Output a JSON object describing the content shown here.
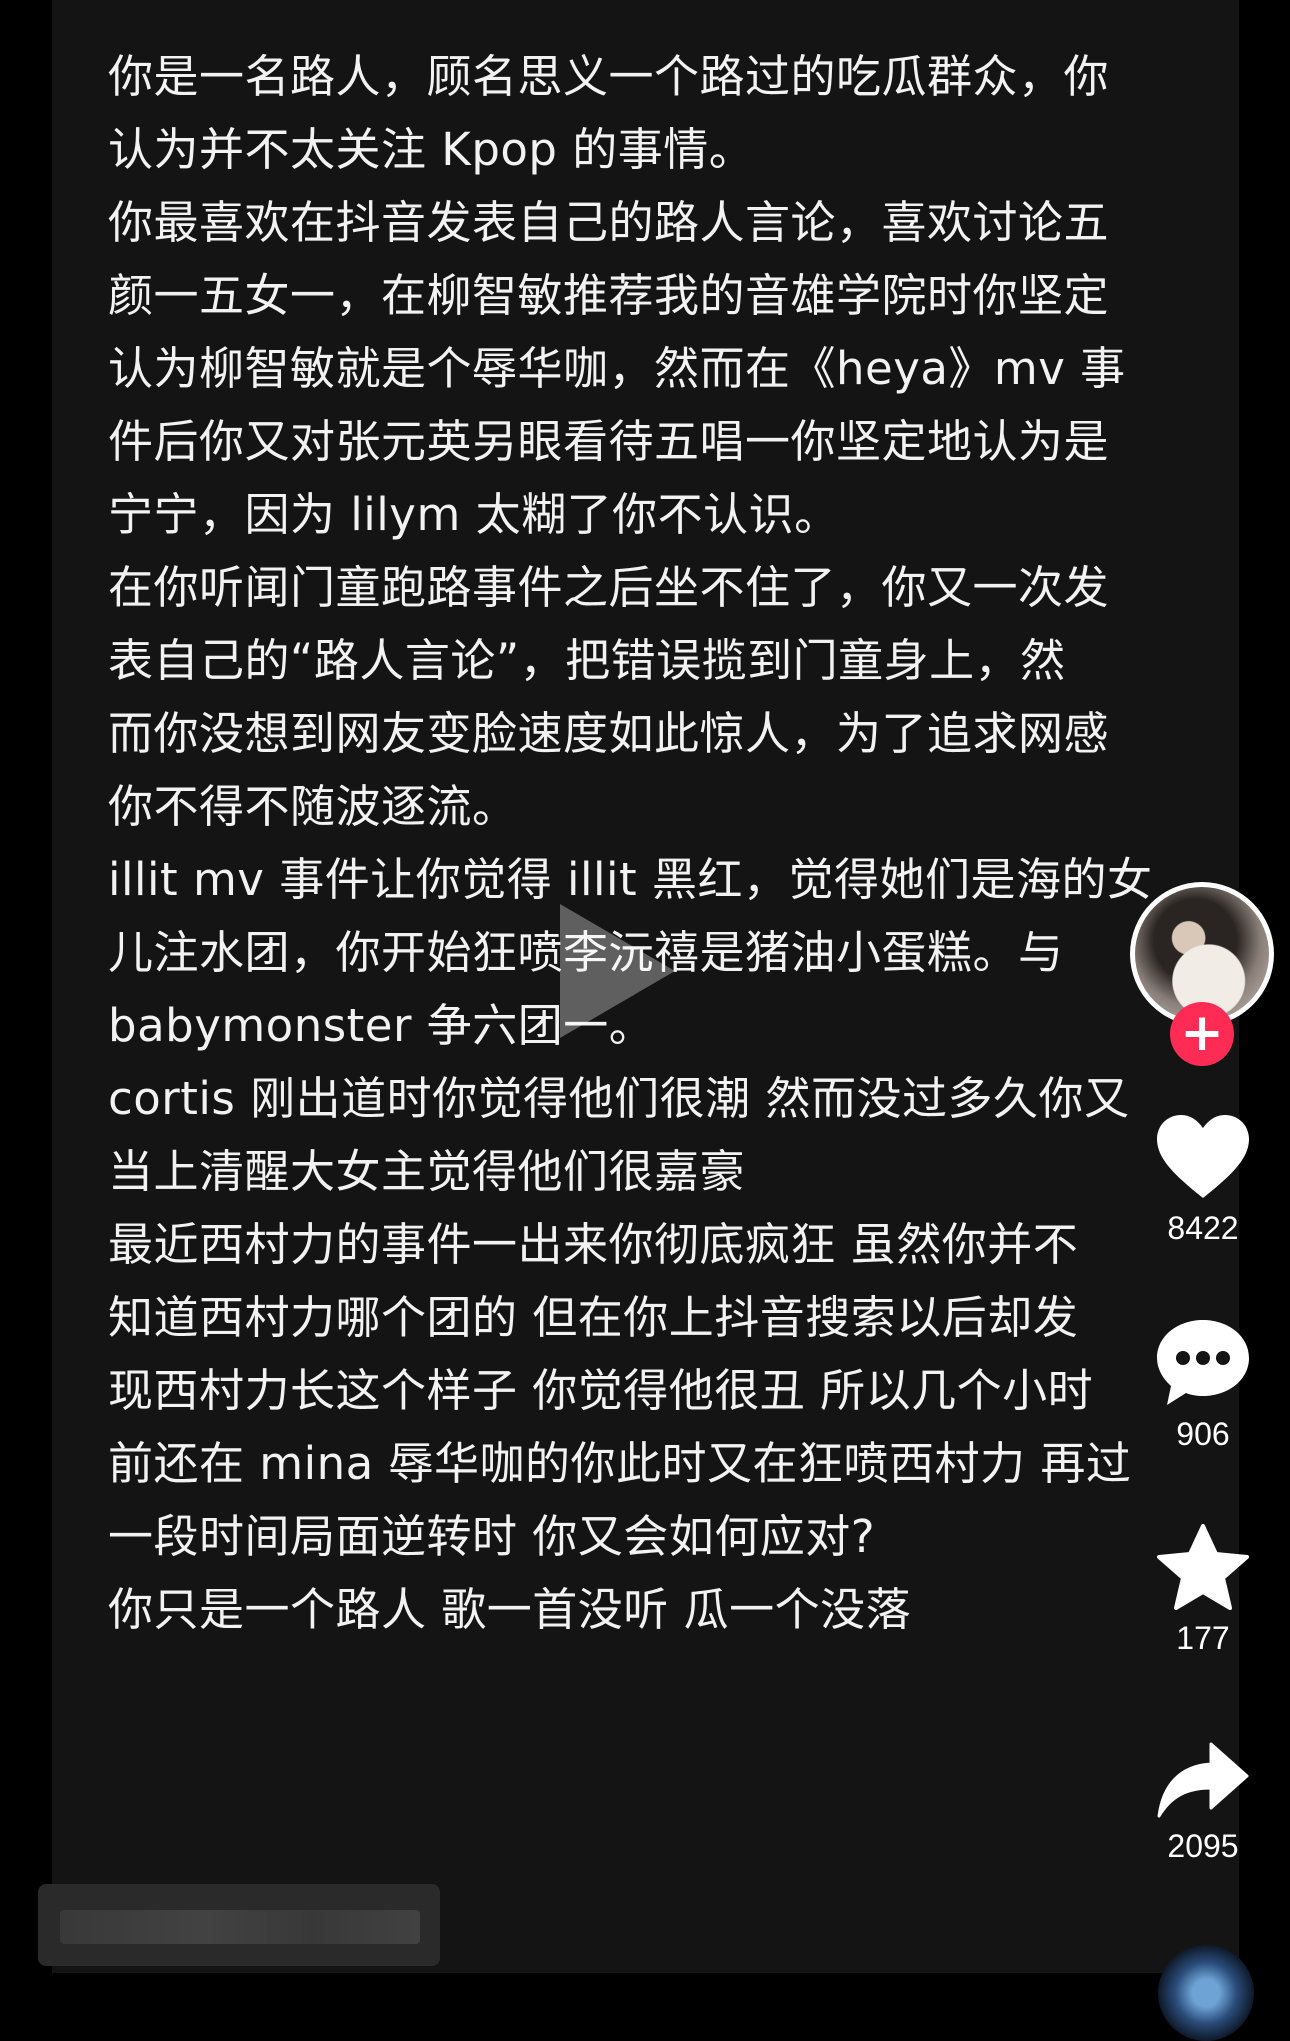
{
  "post": {
    "lines": [
      "你是一名路人，顾名思义一个路过的吃瓜群众，你",
      "认为并不太关注 Kpop 的事情。",
      "你最喜欢在抖音发表自己的路人言论，喜欢讨论五",
      "颜一五女一，在柳智敏推荐我的音雄学院时你坚定",
      "认为柳智敏就是个辱华咖，然而在《heya》mv 事",
      "件后你又对张元英另眼看待五唱一你坚定地认为是",
      "宁宁，因为 lilym 太糊了你不认识。",
      "在你听闻门童跑路事件之后坐不住了，你又一次发",
      "表自己的“路人言论”，把错误揽到门童身上，然",
      "而你没想到网友变脸速度如此惊人，为了追求网感",
      "你不得不随波逐流。",
      "illit mv 事件让你觉得 illit 黑红，觉得她们是海的女",
      "儿注水团，你开始狂喷李沅禧是猪油小蛋糕。与",
      "babymonster 争六团一。",
      "cortis 刚出道时你觉得他们很潮 然而没过多久你又",
      "当上清醒大女主觉得他们很嘉豪",
      "最近西村力的事件一出来你彻底疯狂 虽然你并不",
      "知道西村力哪个团的 但在你上抖音搜索以后却发",
      "现西村力长这个样子 你觉得他很丑 所以几个小时",
      "前还在 mina 辱华咖的你此时又在狂喷西村力 再过",
      "一段时间局面逆转时 你又会如何应对?",
      "你只是一个路人 歌一首没听 瓜一个没落"
    ]
  },
  "side_actions": {
    "follow_symbol": "+",
    "likes": "8422",
    "comments": "906",
    "favorites": "177",
    "shares": "2095"
  },
  "colors": {
    "background": "#000000",
    "panel": "#141414",
    "text": "#f2f2f2",
    "follow_accent": "#fe2c55",
    "icon": "#ffffff"
  },
  "icons": {
    "play": "play-icon",
    "like": "heart-icon",
    "comment": "comment-bubble-icon",
    "favorite": "star-icon",
    "share": "share-arrow-icon",
    "follow": "plus-icon",
    "music": "music-disc-icon"
  }
}
